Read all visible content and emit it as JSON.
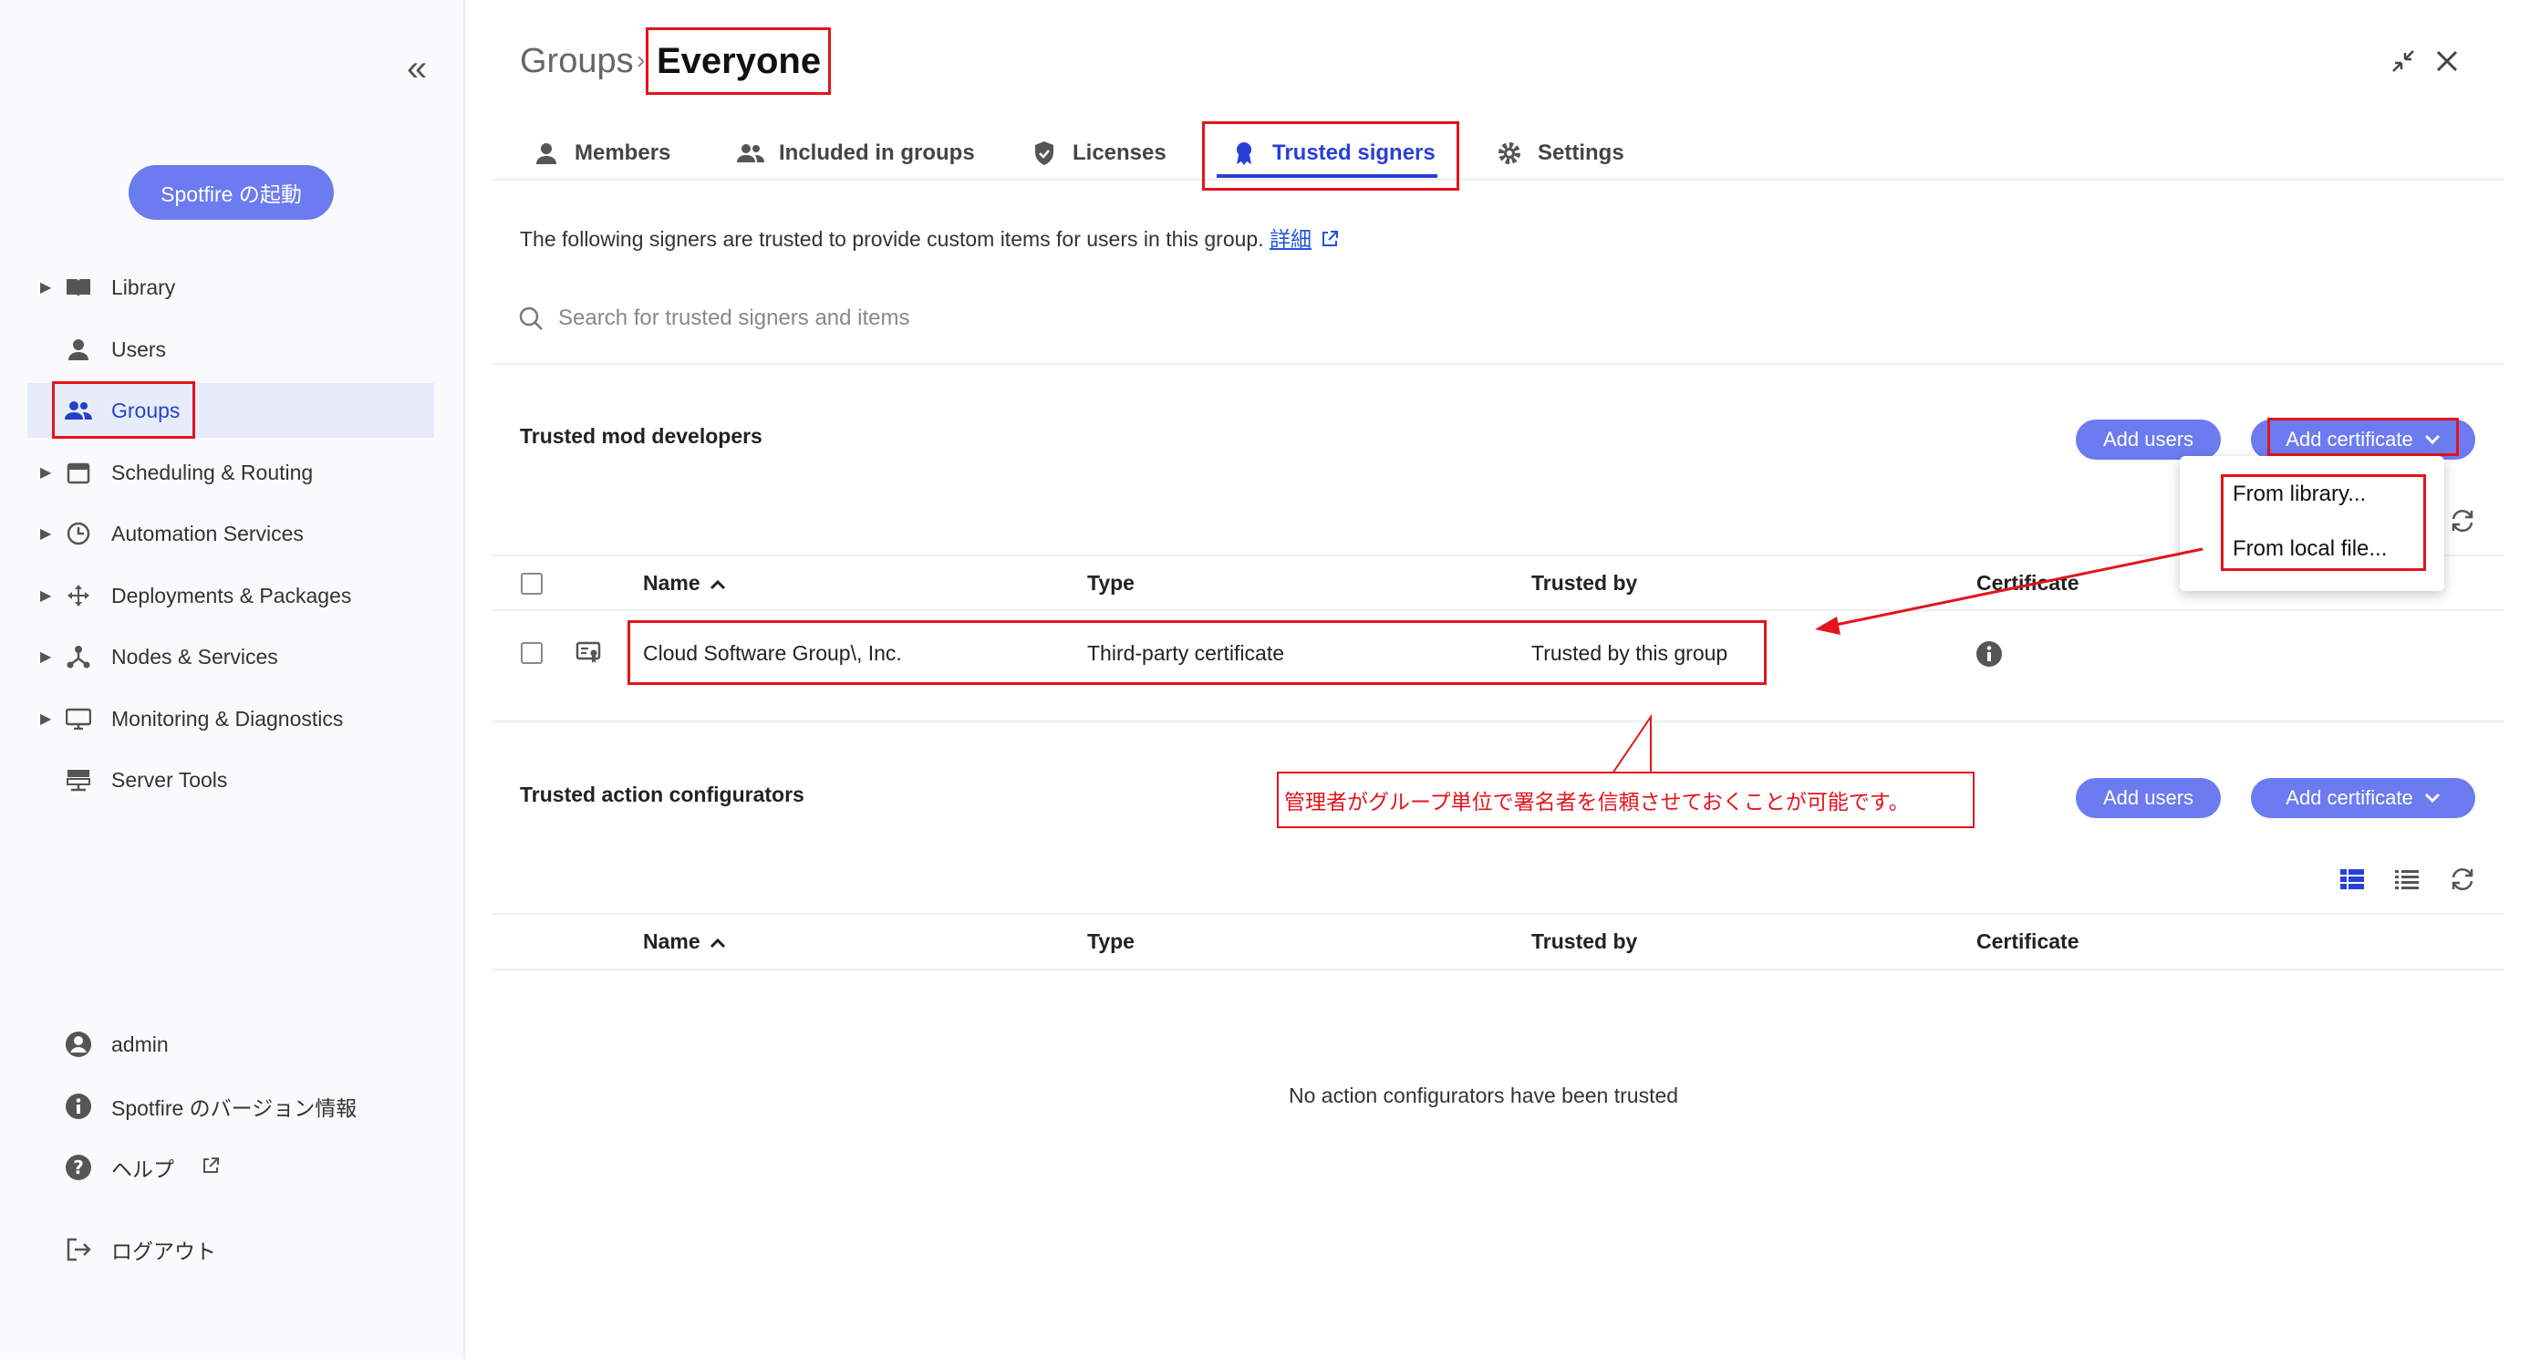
{
  "sidebar": {
    "launch_label": "Spotfire の起動",
    "items": [
      {
        "label": "Library",
        "icon": "book-icon"
      },
      {
        "label": "Users",
        "icon": "person-icon"
      },
      {
        "label": "Groups",
        "icon": "people-icon"
      },
      {
        "label": "Scheduling & Routing",
        "icon": "calendar-icon"
      },
      {
        "label": "Automation Services",
        "icon": "clock-icon"
      },
      {
        "label": "Deployments & Packages",
        "icon": "move-icon"
      },
      {
        "label": "Nodes & Services",
        "icon": "nodes-icon"
      },
      {
        "label": "Monitoring & Diagnostics",
        "icon": "monitor-icon"
      },
      {
        "label": "Server Tools",
        "icon": "server-icon"
      }
    ],
    "bottom": {
      "admin": "admin",
      "version": "Spotfire のバージョン情報",
      "help": "ヘルプ",
      "logout": "ログアウト"
    }
  },
  "header": {
    "breadcrumb_parent": "Groups",
    "breadcrumb_sep": "›",
    "breadcrumb_current": "Everyone"
  },
  "tabs": [
    {
      "label": "Members"
    },
    {
      "label": "Included in groups"
    },
    {
      "label": "Licenses"
    },
    {
      "label": "Trusted signers"
    },
    {
      "label": "Settings"
    }
  ],
  "intro": {
    "text": "The following signers are trusted to provide custom items for users in this group.",
    "link": "詳細"
  },
  "search": {
    "placeholder": "Search for trusted signers and items"
  },
  "mod_section": {
    "title": "Trusted mod developers",
    "add_users": "Add users",
    "add_certificate": "Add certificate",
    "columns": [
      "Name",
      "Type",
      "Trusted by",
      "Certificate"
    ],
    "rows": [
      {
        "name": "Cloud Software Group\\, Inc.",
        "type": "Third-party certificate",
        "trusted_by": "Trusted by this group"
      }
    ]
  },
  "dropdown": {
    "items": [
      "From library...",
      "From local file..."
    ]
  },
  "callout": "管理者がグループ単位で署名者を信頼させておくことが可能です。",
  "action_section": {
    "title": "Trusted action configurators",
    "add_users": "Add users",
    "add_certificate": "Add certificate",
    "columns": [
      "Name",
      "Type",
      "Trusted by",
      "Certificate"
    ],
    "empty": "No action configurators have been trusted"
  },
  "colors": {
    "accent": "#2840d8",
    "pill": "#6c7bf0",
    "annotation": "#e3141c"
  }
}
